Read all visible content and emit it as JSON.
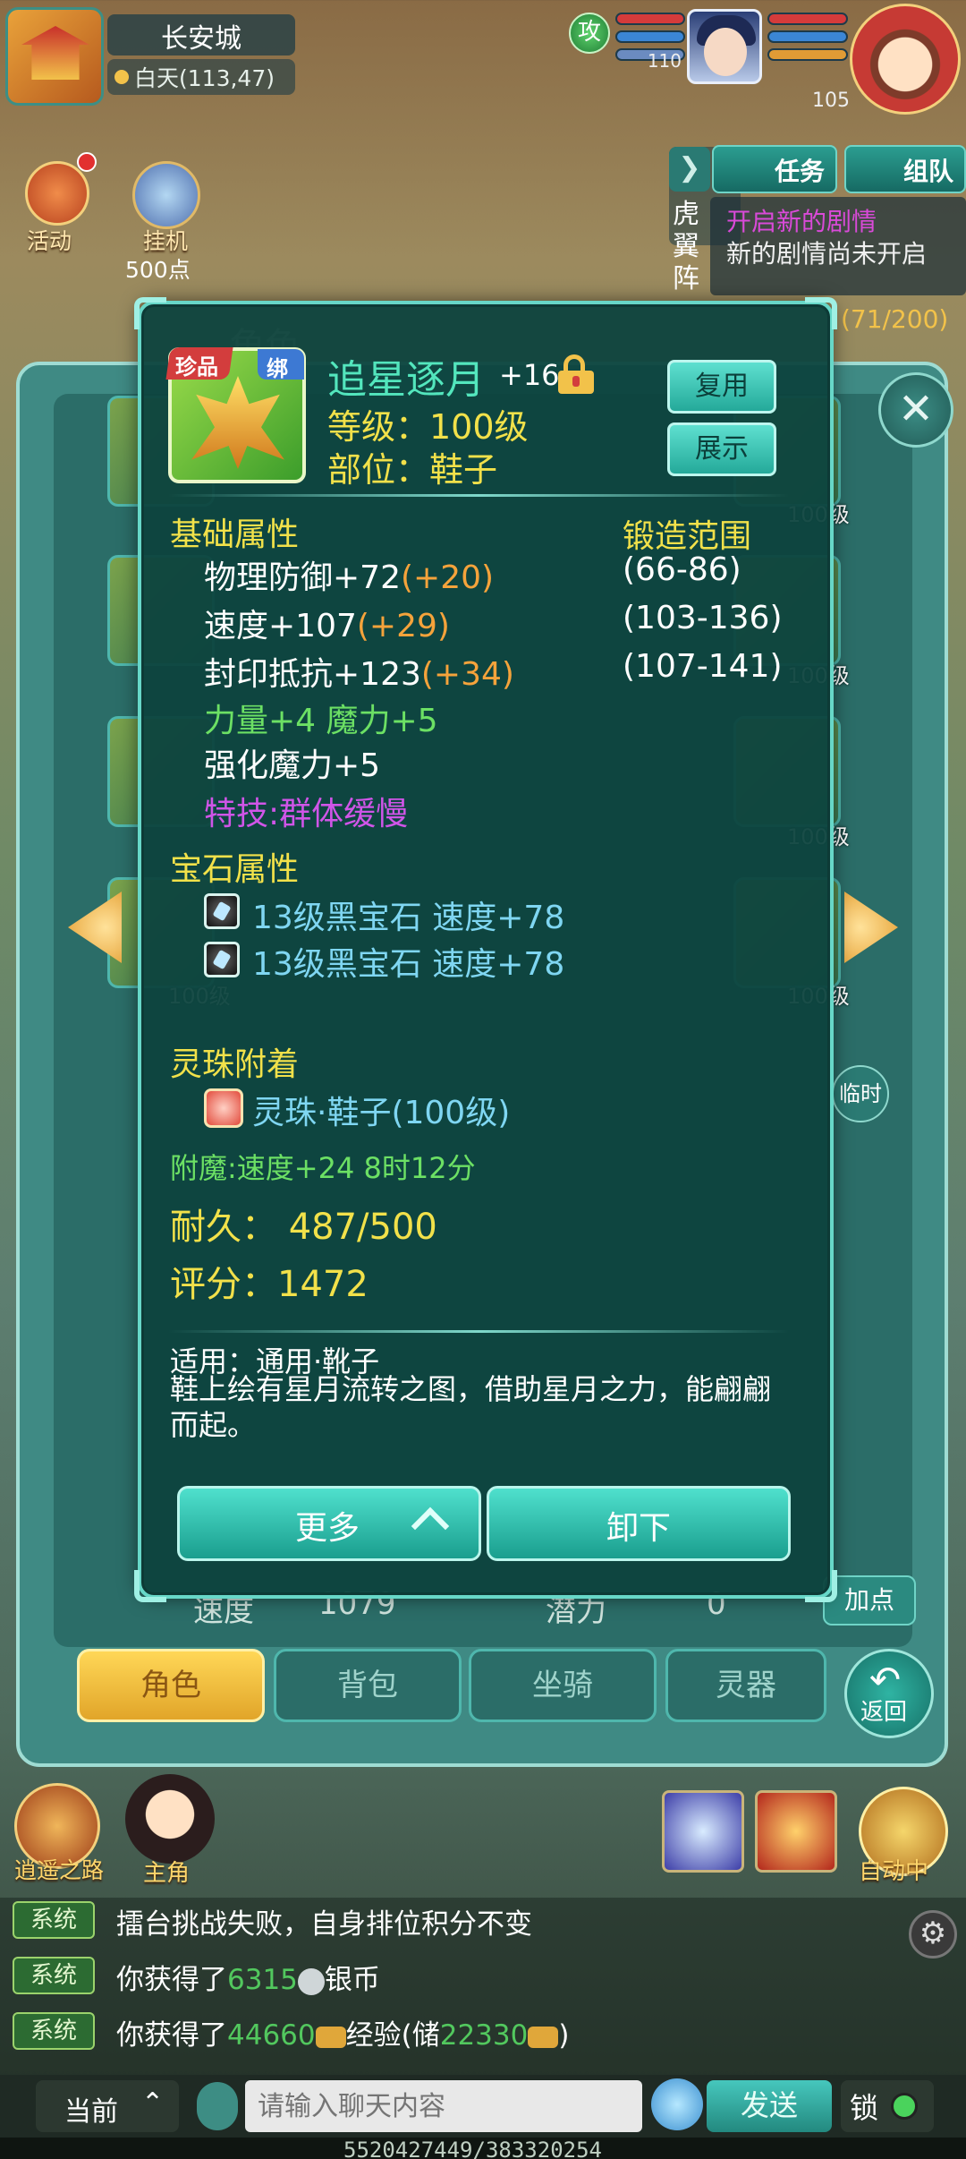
{
  "hud": {
    "city_name": "长安城",
    "city_coords": "白天(113,47)",
    "stance": "攻",
    "pet_level": "110",
    "hero_level": "105",
    "side_skill": "虎翼阵",
    "quest_arrow": "❯",
    "tab_quest": "任务",
    "tab_team": "组队",
    "quest_title": "开启新的剧情",
    "quest_desc": "新的剧情尚未开启",
    "quest_progress": "(71/200)",
    "activity_label": "活动",
    "idle_label": "挂机",
    "idle_points": "500点"
  },
  "char_window": {
    "title": "角色",
    "close": "✕",
    "slot_level": "100级",
    "temp_label": "临时",
    "plus_label": "加点",
    "speed_label": "速度",
    "speed_value": "1079",
    "potential_label": "潜力",
    "potential_value": "0",
    "tabs": [
      "角色",
      "背包",
      "坐骑",
      "灵器"
    ],
    "back_arrow": "↶",
    "back_label": "返回"
  },
  "item": {
    "quality_badge": "珍品",
    "bind_badge": "绑",
    "name": "追星逐月",
    "plus": "+16",
    "level": "等级：100级",
    "slot": "部位：鞋子",
    "reuse_label": "复用",
    "show_label": "展示",
    "base_title": "基础属性",
    "forge_title": "锻造范围",
    "attrs": [
      {
        "text": "物理防御+72",
        "bonus": "(+20)",
        "range": "(66-86)"
      },
      {
        "text": "速度+107",
        "bonus": "(+29)",
        "range": "(103-136)"
      },
      {
        "text": "封印抵抗+123",
        "bonus": "(+34)",
        "range": "(107-141)"
      }
    ],
    "extra_attr": "力量+4 魔力+5",
    "strengthen": "强化魔力+5",
    "special": "特技:群体缓慢",
    "gem_title": "宝石属性",
    "gems": [
      "13级黑宝石 速度+78",
      "13级黑宝石 速度+78"
    ],
    "pearl_title": "灵珠附着",
    "pearl": "灵珠·鞋子(100级)",
    "enchant": "附魔:速度+24  8时12分",
    "durability": "耐久： 487/500",
    "score": "评分：1472",
    "apply": "适用：通用·靴子",
    "desc": "鞋上绘有星月流转之图，借助星月之力，能翩翩而起。",
    "more_label": "更多",
    "unequip_label": "卸下"
  },
  "bottom": {
    "road_label": "逍遥之路",
    "main_char_label": "主角",
    "auto_label": "自动中",
    "chat": [
      {
        "tag": "系统",
        "text": "擂台挑战失败，自身排位积分不变"
      },
      {
        "tag": "系统",
        "pre": "你获得了",
        "num": "6315",
        "unit": "银币"
      },
      {
        "tag": "系统",
        "pre": "你获得了",
        "num": "44660",
        "mid": "经验(储",
        "num2": "22330",
        "end": ")"
      }
    ],
    "current_label": "当前",
    "current_arrow": "⌃",
    "chat_placeholder": "请输入聊天内容",
    "send_label": "发送",
    "lock_label": "锁",
    "server_id": "5520427449/383320254"
  },
  "colors": {
    "item_name": "#53e6bd",
    "attr_yellow": "#f2e14a",
    "bonus_orange": "#f5a33b",
    "green": "#6ce064",
    "purple": "#d055e8",
    "gem_blue": "#7fd6f2"
  }
}
